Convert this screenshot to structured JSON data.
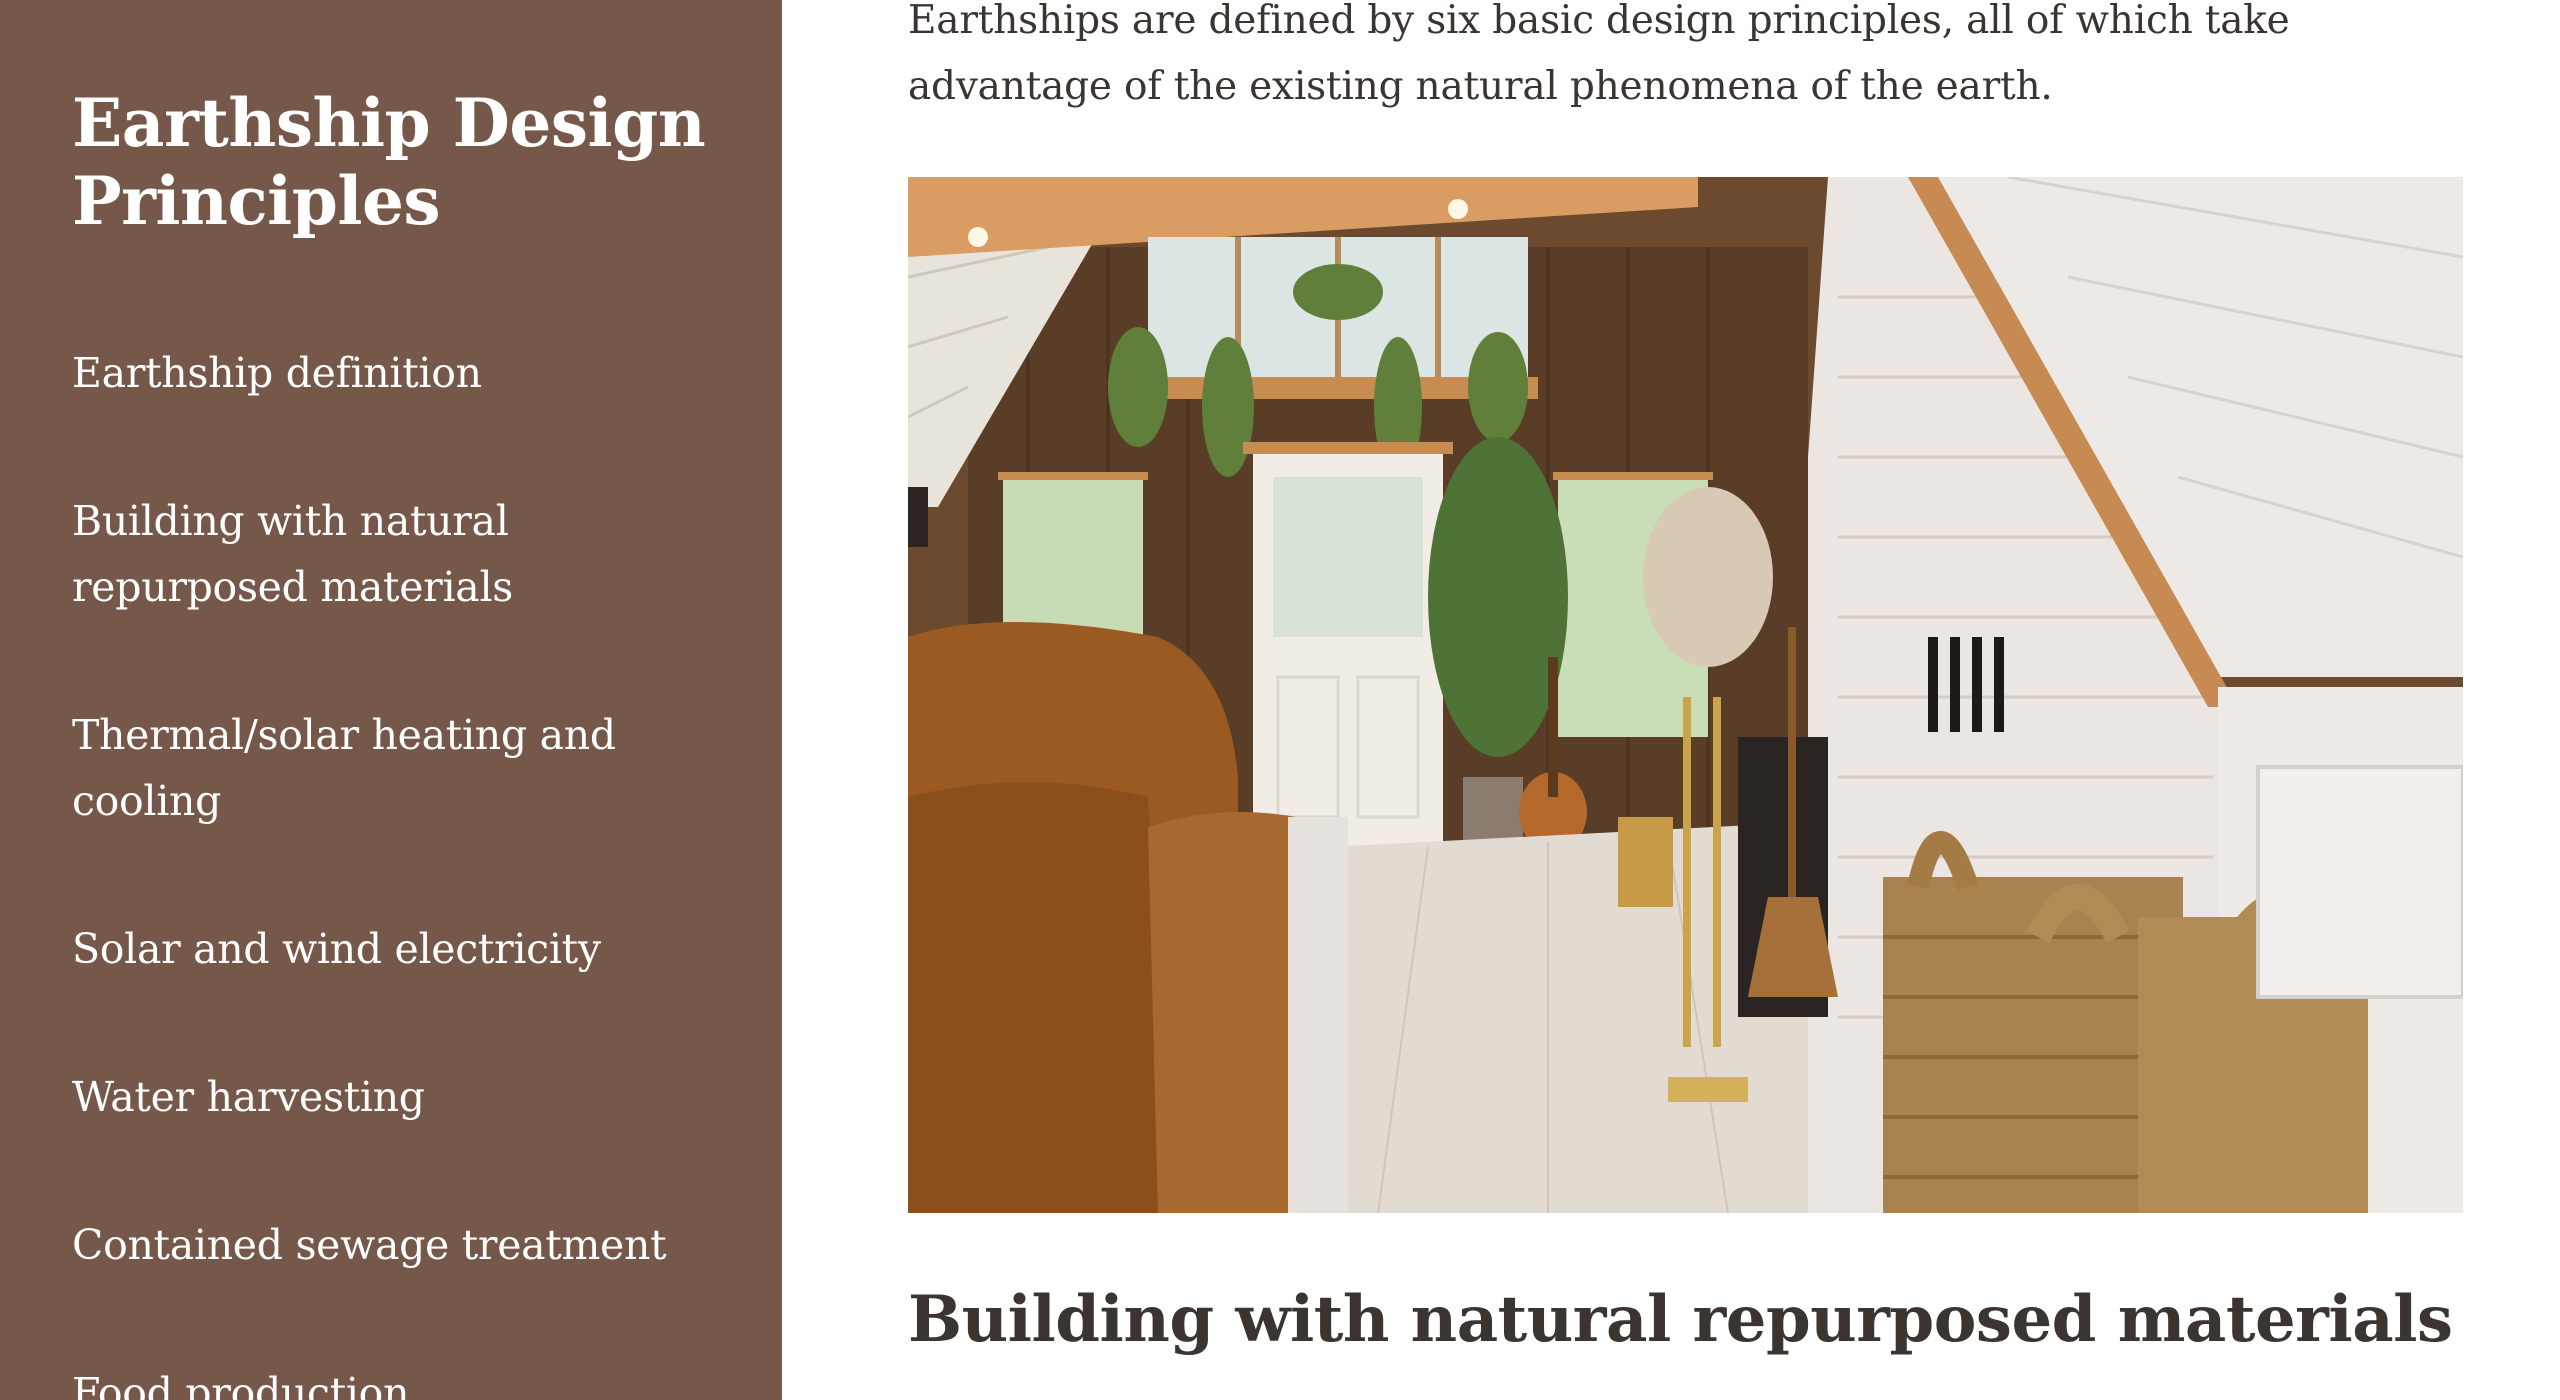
{
  "sidebar": {
    "title": "Earthship Design Principles",
    "background": "#76584a",
    "items": [
      {
        "label": "Earthship definition"
      },
      {
        "label": "Building with natural repurposed materials"
      },
      {
        "label": "Thermal/solar heating and cooling"
      },
      {
        "label": "Solar and wind electricity"
      },
      {
        "label": "Water harvesting"
      },
      {
        "label": "Contained sewage treatment"
      },
      {
        "label": "Food production"
      }
    ]
  },
  "main": {
    "intro_text": "Earthships are defined by six basic design principles, all of which take advantage of the existing natural phenomena of the earth.",
    "image": {
      "icon": "photo-interior-cabin"
    },
    "section_heading": "Building with natural repurposed materials"
  }
}
